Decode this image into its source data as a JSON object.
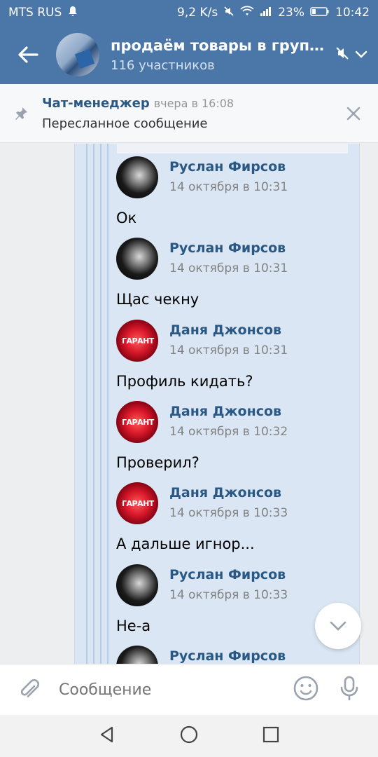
{
  "status_bar": {
    "carrier": "MTS RUS",
    "speed": "9,2 K/s",
    "battery": "23%",
    "time": "10:42"
  },
  "header": {
    "title": "продаём товары в группа...",
    "subtitle": "116 участников",
    "icons": [
      "back-arrow-icon",
      "mute-icon",
      "chevron-down-icon"
    ]
  },
  "pinned": {
    "author": "Чат-менеджер",
    "time": "вчера в 16:08",
    "text": "Пересланное сообщение"
  },
  "messages": [
    {
      "author": "Руслан Фирсов",
      "time": "14 октября в 10:31",
      "text": "Ок",
      "avatar": "ruslan"
    },
    {
      "author": "Руслан Фирсов",
      "time": "14 октября в 10:31",
      "text": "Щас чекну",
      "avatar": "ruslan"
    },
    {
      "author": "Даня Джонсов",
      "time": "14 октября в 10:31",
      "text": "Профиль кидать?",
      "avatar": "danya"
    },
    {
      "author": "Даня Джонсов",
      "time": "14 октября в 10:32",
      "text": "Проверил?",
      "avatar": "danya"
    },
    {
      "author": "Даня Джонсов",
      "time": "14 октября в 10:33",
      "text": "А дальше игнор...",
      "avatar": "danya"
    },
    {
      "author": "Руслан Фирсов",
      "time": "14 октября в 10:33",
      "text": "Не-а",
      "avatar": "ruslan"
    },
    {
      "author": "Руслан Фирсов",
      "time": "",
      "text": "",
      "avatar": "ruslan"
    }
  ],
  "avatar_label_danya": "ГАРАНТ",
  "input": {
    "placeholder": "Сообщение"
  },
  "colors": {
    "header_bg": "#4a76a8",
    "link": "#2a5885",
    "forward_bg": "#dae6f3"
  }
}
